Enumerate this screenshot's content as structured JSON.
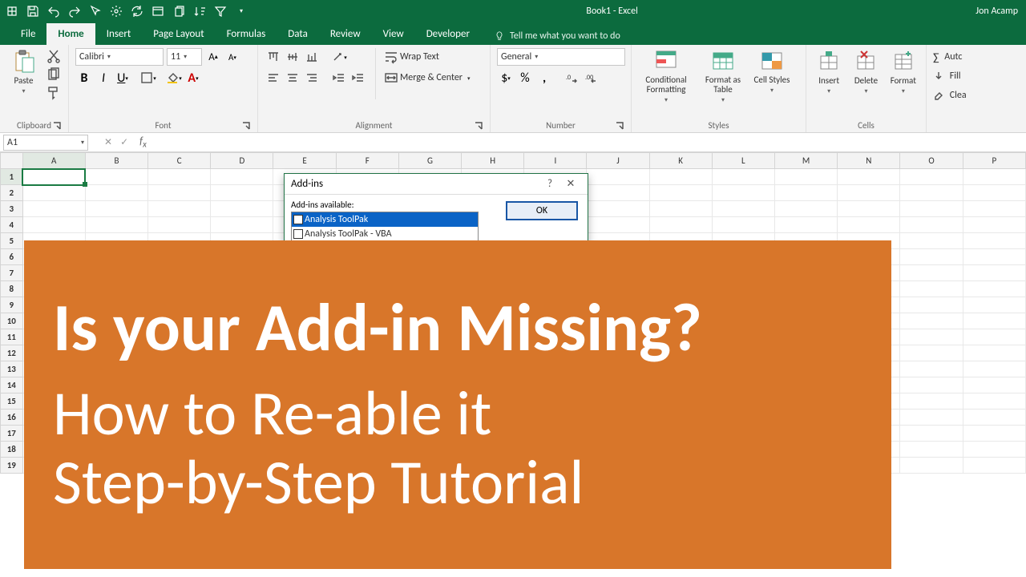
{
  "title": {
    "doc": "Book1 - Excel",
    "user": "Jon Acamp"
  },
  "tabs": [
    "File",
    "Home",
    "Insert",
    "Page Layout",
    "Formulas",
    "Data",
    "Review",
    "View",
    "Developer"
  ],
  "tellme": "Tell me what you want to do",
  "ribbon": {
    "clipboard": {
      "paste": "Paste",
      "label": "Clipboard"
    },
    "font": {
      "name": "Calibri",
      "size": "11",
      "label": "Font"
    },
    "alignment": {
      "wrap": "Wrap Text",
      "merge": "Merge & Center",
      "label": "Alignment"
    },
    "number": {
      "format": "General",
      "label": "Number"
    },
    "styles": {
      "cond": "Conditional Formatting",
      "table": "Format as Table",
      "cell": "Cell Styles",
      "label": "Styles"
    },
    "cells": {
      "insert": "Insert",
      "delete": "Delete",
      "format": "Format",
      "label": "Cells"
    },
    "editing": {
      "autosum": "Autc",
      "fill": "Fill",
      "clear": "Clea"
    }
  },
  "namebox": "A1",
  "columns": [
    "A",
    "B",
    "C",
    "D",
    "E",
    "F",
    "G",
    "H",
    "I",
    "J",
    "K",
    "L",
    "M",
    "N",
    "O",
    "P"
  ],
  "rows": 19,
  "dialog": {
    "title": "Add-ins",
    "label": "Add-ins available:",
    "item1": "Analysis ToolPak",
    "item2": "Analysis ToolPak - VBA",
    "ok": "OK"
  },
  "banner": {
    "line1": "Is your Add-in Missing?",
    "line2": "How to Re-able it",
    "line3": "Step-by-Step Tutorial"
  }
}
